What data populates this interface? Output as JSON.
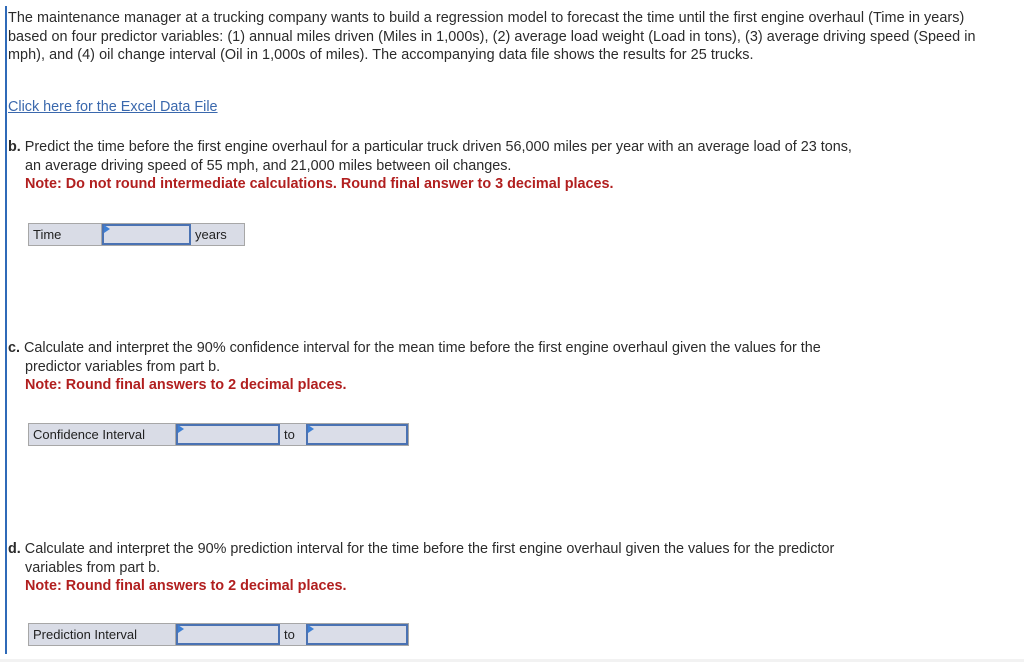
{
  "intro": {
    "text": "The maintenance manager at a trucking company wants to build a regression model to forecast the time until the first engine overhaul (Time in years) based on four predictor variables: (1) annual miles driven (Miles in 1,000s), (2) average load weight (Load in tons), (3) average driving speed (Speed in mph), and (4) oil change interval (Oil in 1,000s of miles). The accompanying data file shows the results for 25 trucks.",
    "link_label": "Click here for the Excel Data File"
  },
  "part_b": {
    "letter": "b.",
    "text": " Predict the time before the first engine overhaul for a particular truck driven 56,000 miles per year with an average load of 23 tons,",
    "text_cont": "an average driving speed of 55 mph, and 21,000 miles between oil changes.",
    "note": "Note: Do not round intermediate calculations. Round final answer to 3 decimal places.",
    "row_label": "Time",
    "value": "",
    "unit": "years"
  },
  "part_c": {
    "letter": "c.",
    "text": " Calculate and interpret the 90% confidence interval for the mean time before the first engine overhaul given the values for the",
    "text_cont": "predictor variables from part b.",
    "note": "Note: Round final answers to 2 decimal places.",
    "row_label": "Confidence Interval",
    "lower": "",
    "separator": "to",
    "upper": ""
  },
  "part_d": {
    "letter": "d.",
    "text": " Calculate and interpret the 90% prediction interval for the time before the first engine overhaul given the values for the predictor",
    "text_cont": "variables from part b.",
    "note": "Note: Round final answers to 2 decimal places.",
    "row_label": "Prediction Interval",
    "lower": "",
    "separator": "to",
    "upper": ""
  }
}
